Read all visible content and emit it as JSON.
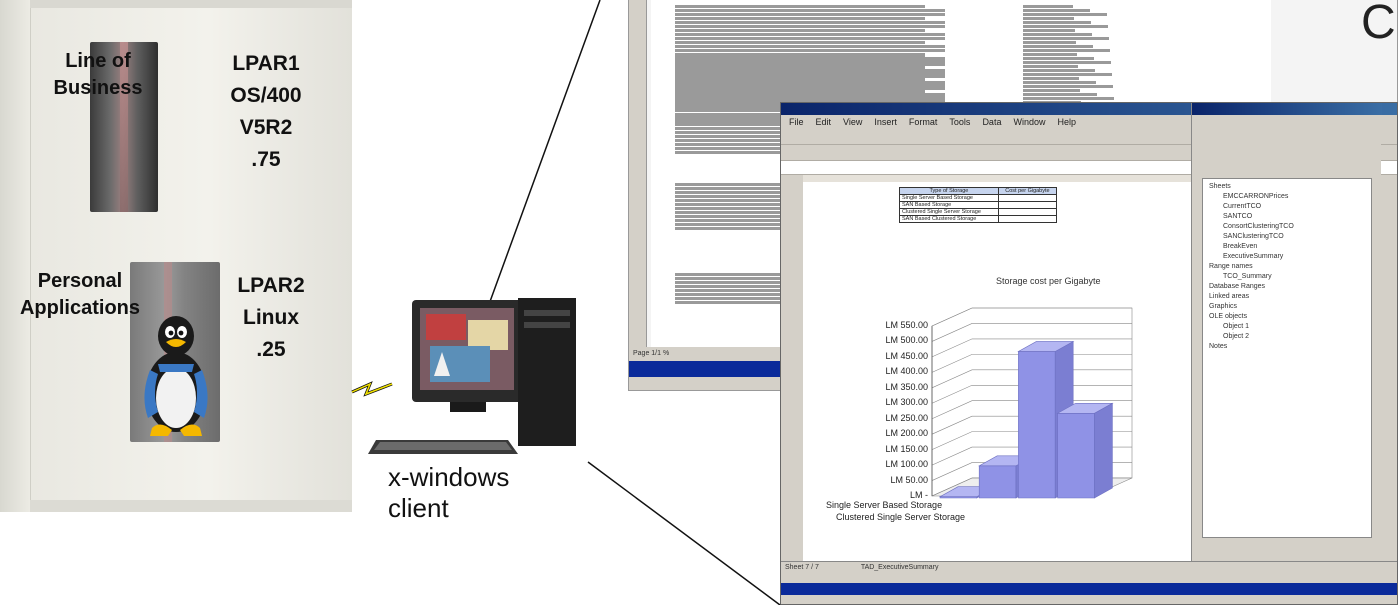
{
  "server": {
    "lpar1_workload": [
      "Line of",
      "Business"
    ],
    "lpar1_info": [
      "LPAR1",
      "OS/400",
      "V5R2",
      ".75"
    ],
    "lpar2_workload": [
      "Personal",
      "Applications"
    ],
    "lpar2_info": [
      "LPAR2",
      "Linux",
      ".25"
    ]
  },
  "client": {
    "label": [
      "x-windows",
      "client"
    ]
  },
  "back_window": {
    "partial_heading": "C",
    "status_text": "Page 1/1 %"
  },
  "front_window": {
    "menu": [
      "File",
      "Edit",
      "View",
      "Insert",
      "Format",
      "Tools",
      "Data",
      "Window",
      "Help"
    ],
    "cost_table": {
      "headers": [
        "Type of Storage",
        "Cost per Gigabyte"
      ],
      "rows": [
        [
          "Single Server Based Storage",
          ""
        ],
        [
          "SAN Based Storage",
          ""
        ],
        [
          "Clustered Single Server Storage",
          ""
        ],
        [
          "SAN Based Clustered Storage",
          ""
        ]
      ]
    },
    "tree_items": [
      "Sheets",
      "EMCCARRONPrices",
      "CurrentTCO",
      "SANTCO",
      "ConsortClusteringTCO",
      "SANClusteringTCO",
      "BreakEven",
      "ExecutiveSummary",
      "Range names",
      "TCO_Summary",
      "Database Ranges",
      "Linked areas",
      "Graphics",
      "OLE objects",
      "Object 1",
      "Object 2",
      "Notes"
    ],
    "sheet_status": "Sheet 7 / 7",
    "sheet_name": "TAD_ExecutiveSummary"
  },
  "chart_data": {
    "type": "bar",
    "title": "Storage cost per Gigabyte",
    "categories": [
      "Single Server Based Storage",
      "SAN Based Storage",
      "Clustered Single Server Storage",
      "SAN Based Clustered Storage"
    ],
    "x_tick_labels": [
      "Single Server Based Storage",
      "Clustered Single Server Storage"
    ],
    "values": [
      30,
      130,
      500,
      300
    ],
    "y_ticks": [
      "LM 550.00",
      "LM 500.00",
      "LM 450.00",
      "LM 400.00",
      "LM 350.00",
      "LM 300.00",
      "LM 250.00",
      "LM 200.00",
      "LM 150.00",
      "LM 100.00",
      "LM 50.00",
      "LM -"
    ],
    "ylim": [
      0,
      550
    ],
    "bar_color": "#8f92e6",
    "grid": true,
    "style": "3d"
  },
  "colors": {
    "window_bg": "#d4d0c8",
    "titlebar": "#0a246a",
    "taskbar": "#0a2a9a",
    "connector": "#111111",
    "lightning": "#f2e200"
  }
}
